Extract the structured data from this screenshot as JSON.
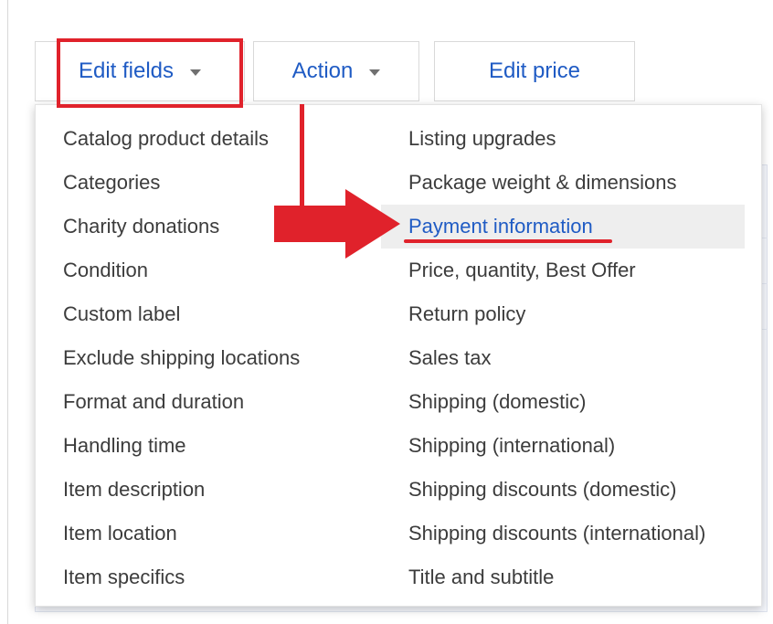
{
  "toolbar": {
    "edit_fields_label": "Edit fields",
    "action_label": "Action",
    "edit_price_label": "Edit price"
  },
  "menu": {
    "left_items": [
      "Catalog product details",
      "Categories",
      "Charity donations",
      "Condition",
      "Custom label",
      "Exclude shipping locations",
      "Format and duration",
      "Handling time",
      "Item description",
      "Item location",
      "Item specifics"
    ],
    "right_items": [
      "Listing upgrades",
      "Package weight & dimensions",
      "Payment information",
      "Price, quantity, Best Offer",
      "Return policy",
      "Sales tax",
      "Shipping (domestic)",
      "Shipping (international)",
      "Shipping discounts (domestic)",
      "Shipping discounts (international)",
      "Title and subtitle"
    ],
    "active_item": "Payment information"
  },
  "colors": {
    "link_blue": "#1f5bc4",
    "annotation_red": "#e0222b",
    "text": "#3c3c3c"
  },
  "icons": {
    "dropdown": "chevron-down-icon",
    "annotation_arrow": "arrow-right-icon"
  }
}
